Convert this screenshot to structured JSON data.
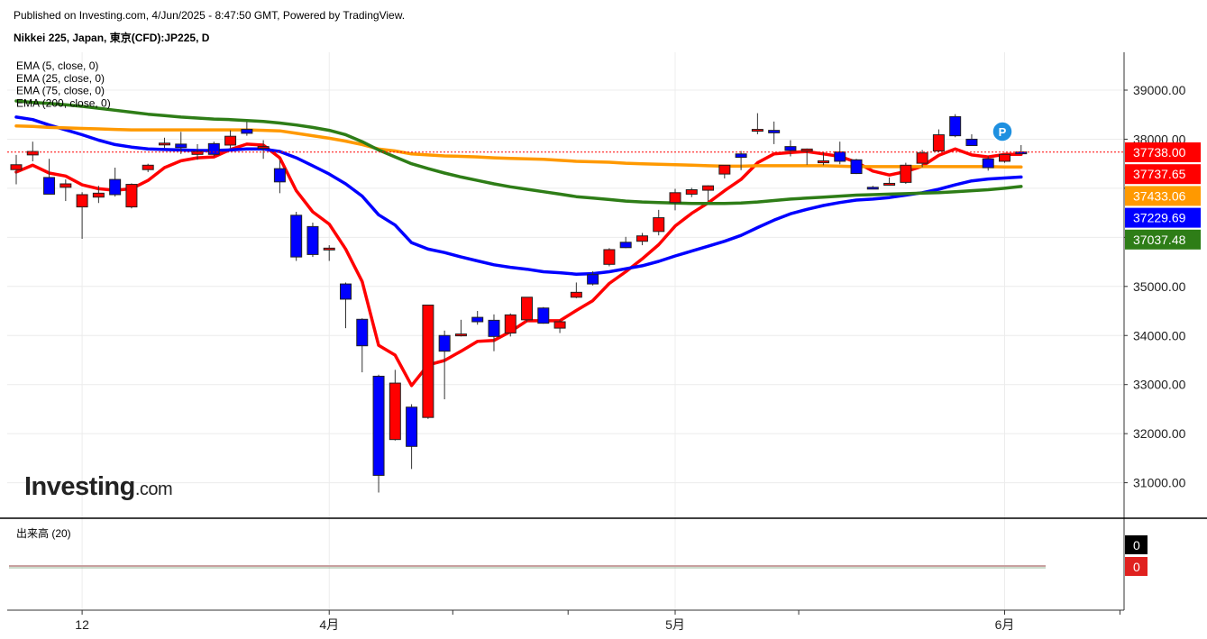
{
  "header": {
    "published": "Published on Investing.com, 4/Jun/2025 - 8:47:50 GMT, Powered by TradingView.",
    "symbol": "Nikkei 225, Japan, 東京(CFD):JP225, D"
  },
  "logo": {
    "text": "Investing",
    "suffix": ".com"
  },
  "chart_data": {
    "type": "candlestick",
    "ylim": [
      30300,
      39800
    ],
    "y_ticks": [
      31000,
      32000,
      33000,
      34000,
      35000,
      36000,
      37000,
      38000,
      39000
    ],
    "y_tick_labels": [
      "31000.00",
      "32000.00",
      "33000.00",
      "34000.00",
      "35000.00",
      "",
      "",
      "38000.00",
      "39000.00"
    ],
    "x_tick_labels": [
      {
        "label": "12",
        "index": 4
      },
      {
        "label": "4月",
        "index": 19
      },
      {
        "label": "5月",
        "index": 40
      },
      {
        "label": "6月",
        "index": 60
      }
    ],
    "x_minor_ticks": [
      26.5,
      33.5,
      47.5,
      67
    ],
    "candles": [
      {
        "o": 37380,
        "h": 37680,
        "l": 37080,
        "c": 37480
      },
      {
        "o": 37680,
        "h": 37950,
        "l": 37550,
        "c": 37750
      },
      {
        "o": 37220,
        "h": 37600,
        "l": 36900,
        "c": 36880
      },
      {
        "o": 37020,
        "h": 37180,
        "l": 36740,
        "c": 37090
      },
      {
        "o": 36620,
        "h": 36920,
        "l": 35970,
        "c": 36870
      },
      {
        "o": 36820,
        "h": 37050,
        "l": 36700,
        "c": 36900
      },
      {
        "o": 37180,
        "h": 37420,
        "l": 36830,
        "c": 36870
      },
      {
        "o": 36620,
        "h": 37100,
        "l": 36590,
        "c": 37080
      },
      {
        "o": 37380,
        "h": 37500,
        "l": 37330,
        "c": 37470
      },
      {
        "o": 37890,
        "h": 38030,
        "l": 37820,
        "c": 37920
      },
      {
        "o": 37900,
        "h": 38150,
        "l": 37700,
        "c": 37830
      },
      {
        "o": 37690,
        "h": 37900,
        "l": 37580,
        "c": 37750
      },
      {
        "o": 37910,
        "h": 37950,
        "l": 37650,
        "c": 37690
      },
      {
        "o": 37880,
        "h": 38180,
        "l": 37820,
        "c": 38060
      },
      {
        "o": 38200,
        "h": 38350,
        "l": 38070,
        "c": 38120
      },
      {
        "o": 37840,
        "h": 37980,
        "l": 37600,
        "c": 37850
      },
      {
        "o": 37400,
        "h": 37570,
        "l": 36900,
        "c": 37130
      },
      {
        "o": 36450,
        "h": 36520,
        "l": 35520,
        "c": 35600
      },
      {
        "o": 36220,
        "h": 36300,
        "l": 35600,
        "c": 35650
      },
      {
        "o": 35760,
        "h": 35840,
        "l": 35520,
        "c": 35780
      },
      {
        "o": 35050,
        "h": 35080,
        "l": 34150,
        "c": 34740
      },
      {
        "o": 34330,
        "h": 34350,
        "l": 33250,
        "c": 33790
      },
      {
        "o": 33170,
        "h": 33200,
        "l": 30800,
        "c": 31150
      },
      {
        "o": 31880,
        "h": 33300,
        "l": 31860,
        "c": 33030
      },
      {
        "o": 32540,
        "h": 32600,
        "l": 31280,
        "c": 31740
      },
      {
        "o": 32330,
        "h": 34620,
        "l": 32300,
        "c": 34620
      },
      {
        "o": 34000,
        "h": 34100,
        "l": 32700,
        "c": 33680
      },
      {
        "o": 34020,
        "h": 34320,
        "l": 33980,
        "c": 34030
      },
      {
        "o": 34370,
        "h": 34500,
        "l": 34220,
        "c": 34280
      },
      {
        "o": 34310,
        "h": 34430,
        "l": 33680,
        "c": 33980
      },
      {
        "o": 34050,
        "h": 34450,
        "l": 33980,
        "c": 34420
      },
      {
        "o": 34320,
        "h": 34770,
        "l": 34280,
        "c": 34780
      },
      {
        "o": 34560,
        "h": 34580,
        "l": 34240,
        "c": 34250
      },
      {
        "o": 34150,
        "h": 34320,
        "l": 34050,
        "c": 34280
      },
      {
        "o": 34780,
        "h": 35080,
        "l": 34760,
        "c": 34880
      },
      {
        "o": 35240,
        "h": 35310,
        "l": 35020,
        "c": 35050
      },
      {
        "o": 35450,
        "h": 35780,
        "l": 35410,
        "c": 35750
      },
      {
        "o": 35900,
        "h": 36010,
        "l": 35780,
        "c": 35790
      },
      {
        "o": 35920,
        "h": 36090,
        "l": 35840,
        "c": 36030
      },
      {
        "o": 36120,
        "h": 36560,
        "l": 36040,
        "c": 36400
      },
      {
        "o": 36710,
        "h": 36990,
        "l": 36550,
        "c": 36910
      },
      {
        "o": 36880,
        "h": 37010,
        "l": 36820,
        "c": 36970
      },
      {
        "o": 36960,
        "h": 37060,
        "l": 36740,
        "c": 37050
      },
      {
        "o": 37290,
        "h": 37350,
        "l": 37200,
        "c": 37470
      },
      {
        "o": 37700,
        "h": 37760,
        "l": 37370,
        "c": 37630
      },
      {
        "o": 38180,
        "h": 38530,
        "l": 38100,
        "c": 38200
      },
      {
        "o": 38180,
        "h": 38360,
        "l": 37900,
        "c": 38130
      },
      {
        "o": 37850,
        "h": 37980,
        "l": 37650,
        "c": 37770
      },
      {
        "o": 37760,
        "h": 37810,
        "l": 37480,
        "c": 37800
      },
      {
        "o": 37520,
        "h": 37740,
        "l": 37470,
        "c": 37560
      },
      {
        "o": 37740,
        "h": 37950,
        "l": 37490,
        "c": 37550
      },
      {
        "o": 37580,
        "h": 37600,
        "l": 37290,
        "c": 37300
      },
      {
        "o": 37020,
        "h": 37050,
        "l": 36980,
        "c": 37010
      },
      {
        "o": 37090,
        "h": 37220,
        "l": 37060,
        "c": 37100
      },
      {
        "o": 37120,
        "h": 37520,
        "l": 37090,
        "c": 37470
      },
      {
        "o": 37510,
        "h": 37780,
        "l": 37430,
        "c": 37720
      },
      {
        "o": 37760,
        "h": 38200,
        "l": 37740,
        "c": 38090
      },
      {
        "o": 38460,
        "h": 38510,
        "l": 38040,
        "c": 38070
      },
      {
        "o": 38000,
        "h": 38100,
        "l": 37880,
        "c": 37870
      },
      {
        "o": 37600,
        "h": 37650,
        "l": 37360,
        "c": 37420
      },
      {
        "o": 37550,
        "h": 37680,
        "l": 37520,
        "c": 37690
      },
      {
        "o": 37740,
        "h": 37880,
        "l": 37700,
        "c": 37738
      }
    ],
    "series": [
      {
        "name": "EMA (5, close, 0)",
        "color": "#ff0000",
        "values": [
          37330,
          37470,
          37310,
          37250,
          37070,
          36990,
          36960,
          36990,
          37160,
          37420,
          37560,
          37620,
          37640,
          37790,
          37900,
          37880,
          37620,
          36950,
          36520,
          36270,
          35760,
          35100,
          33800,
          33600,
          32980,
          33400,
          33490,
          33680,
          33880,
          33900,
          34080,
          34300,
          34300,
          34300,
          34510,
          34710,
          35060,
          35300,
          35560,
          35850,
          36230,
          36490,
          36700,
          36950,
          37180,
          37520,
          37700,
          37730,
          37750,
          37700,
          37650,
          37530,
          37350,
          37270,
          37340,
          37450,
          37670,
          37800,
          37680,
          37640,
          37690,
          37690
        ]
      },
      {
        "name": "EMA (25, close, 0)",
        "color": "#0000ff",
        "values": [
          38450,
          38400,
          38290,
          38190,
          38090,
          37980,
          37890,
          37840,
          37800,
          37790,
          37780,
          37770,
          37770,
          37780,
          37800,
          37800,
          37750,
          37620,
          37460,
          37290,
          37090,
          36840,
          36460,
          36250,
          35890,
          35760,
          35690,
          35600,
          35520,
          35440,
          35390,
          35350,
          35300,
          35280,
          35250,
          35260,
          35300,
          35360,
          35420,
          35510,
          35620,
          35720,
          35820,
          35920,
          36040,
          36200,
          36350,
          36480,
          36570,
          36650,
          36710,
          36760,
          36780,
          36810,
          36860,
          36910,
          36980,
          37070,
          37150,
          37190,
          37210,
          37230
        ]
      },
      {
        "name": "EMA (75, close, 0)",
        "color": "#ff9900",
        "values": [
          38270,
          38260,
          38240,
          38230,
          38220,
          38210,
          38200,
          38190,
          38190,
          38190,
          38190,
          38190,
          38190,
          38190,
          38190,
          38180,
          38170,
          38120,
          38070,
          38020,
          37960,
          37890,
          37800,
          37760,
          37700,
          37680,
          37660,
          37650,
          37640,
          37620,
          37610,
          37600,
          37590,
          37570,
          37550,
          37540,
          37530,
          37510,
          37500,
          37490,
          37480,
          37470,
          37460,
          37450,
          37450,
          37460,
          37460,
          37460,
          37460,
          37460,
          37450,
          37440,
          37440,
          37440,
          37440,
          37440,
          37440,
          37440,
          37440,
          37440,
          37433,
          37433
        ]
      },
      {
        "name": "EMA (200, close, 0)",
        "color": "#2e7d17",
        "values": [
          38780,
          38750,
          38730,
          38700,
          38670,
          38630,
          38590,
          38550,
          38510,
          38480,
          38450,
          38430,
          38410,
          38400,
          38380,
          38360,
          38330,
          38290,
          38240,
          38180,
          38090,
          37950,
          37780,
          37640,
          37500,
          37400,
          37310,
          37230,
          37160,
          37090,
          37030,
          36980,
          36930,
          36880,
          36830,
          36800,
          36770,
          36740,
          36720,
          36710,
          36700,
          36690,
          36690,
          36690,
          36700,
          36720,
          36750,
          36780,
          36800,
          36820,
          36840,
          36860,
          36870,
          36880,
          36890,
          36900,
          36910,
          36930,
          36950,
          36970,
          37000,
          37037
        ]
      }
    ],
    "price_labels": [
      {
        "text": "37738.00",
        "color": "#ff0000"
      },
      {
        "text": "37737.65",
        "color": "#ff0000"
      },
      {
        "text": "37433.06",
        "color": "#ff9900"
      },
      {
        "text": "37229.69",
        "color": "#0000ff"
      },
      {
        "text": "37037.48",
        "color": "#2e7d17"
      }
    ],
    "current_price": 37738,
    "up_color": "#ff0000",
    "down_color": "#0000ff",
    "legend": [
      "EMA (5, close, 0)",
      "EMA (25, close, 0)",
      "EMA (75, close, 0)",
      "EMA (200, close, 0)"
    ],
    "marker": "P",
    "grid": true,
    "volume_pane": {
      "title": "出来高 (20)",
      "labels": [
        {
          "text": "0",
          "color": "#000000"
        },
        {
          "text": "0",
          "color": "#e0211f"
        }
      ]
    }
  }
}
